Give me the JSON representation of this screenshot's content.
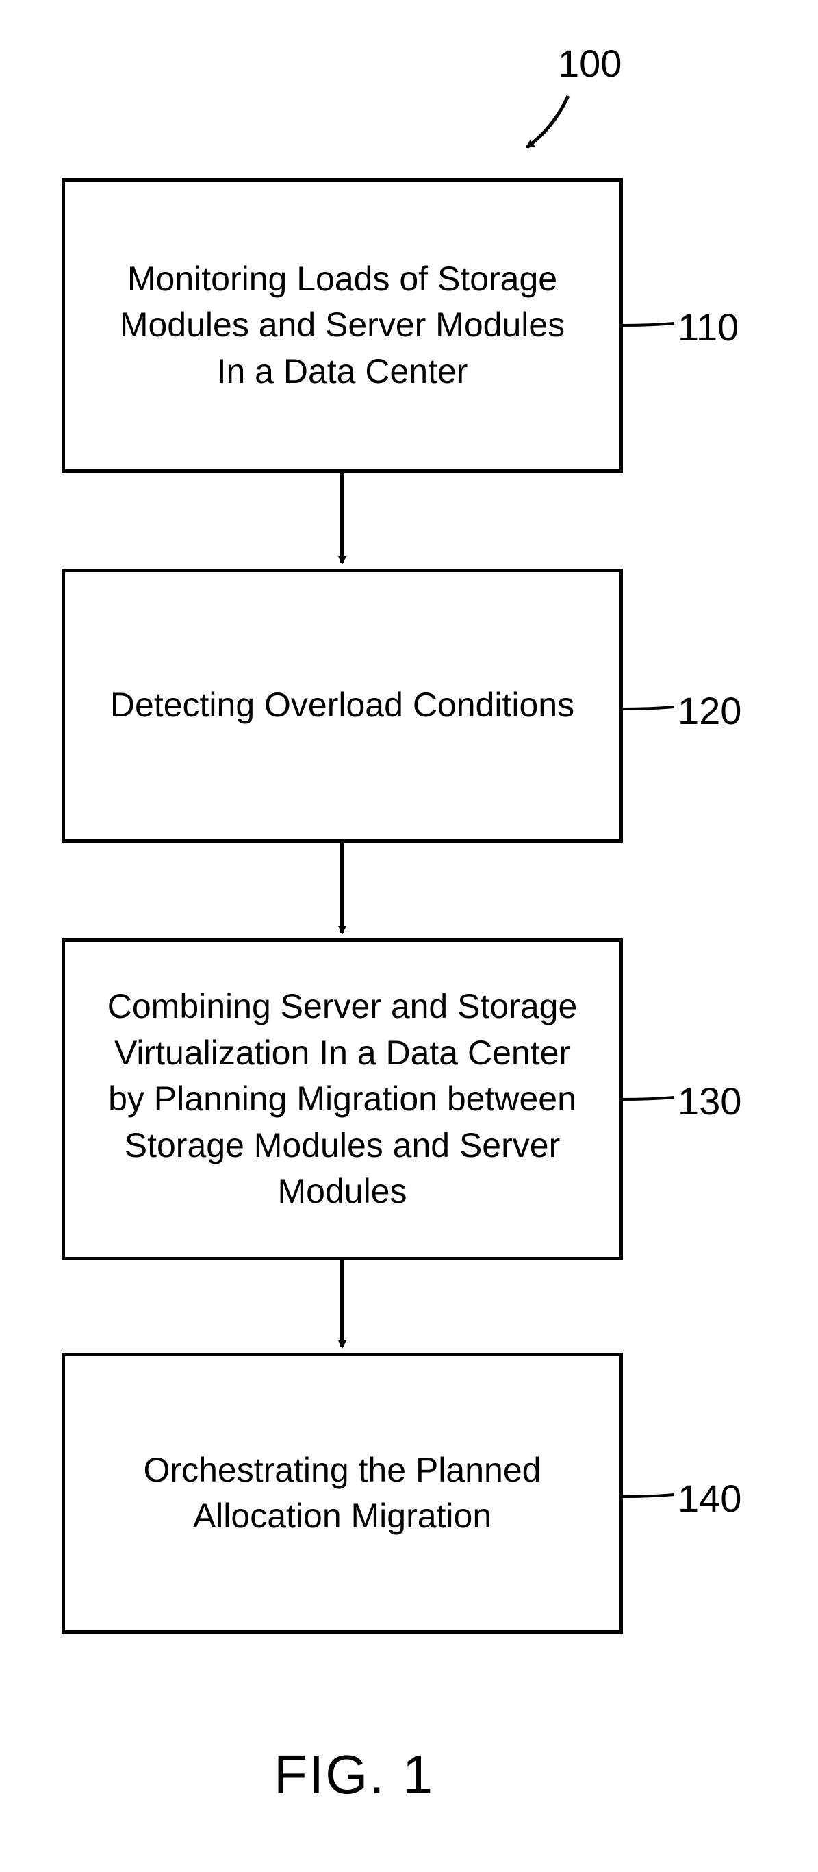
{
  "figure": {
    "ref_main": "100",
    "caption": "FIG. 1"
  },
  "boxes": {
    "b110": {
      "text": "Monitoring Loads of Storage Modules and Server Modules In a Data Center",
      "ref": "110"
    },
    "b120": {
      "text": "Detecting Overload Conditions",
      "ref": "120"
    },
    "b130": {
      "text": "Combining Server and Storage Virtualization In a Data Center by Planning Migration between Storage Modules and Server Modules",
      "ref": "130"
    },
    "b140": {
      "text": "Orchestrating the Planned Allocation Migration",
      "ref": "140"
    }
  },
  "chart_data": {
    "type": "flowchart",
    "title": "FIG. 1",
    "reference_numeral": "100",
    "nodes": [
      {
        "id": "110",
        "label": "Monitoring Loads of Storage Modules and Server Modules In a Data Center"
      },
      {
        "id": "120",
        "label": "Detecting Overload Conditions"
      },
      {
        "id": "130",
        "label": "Combining Server and Storage Virtualization In a Data Center by Planning Migration between Storage Modules and Server Modules"
      },
      {
        "id": "140",
        "label": "Orchestrating the Planned Allocation Migration"
      }
    ],
    "edges": [
      {
        "from": "110",
        "to": "120"
      },
      {
        "from": "120",
        "to": "130"
      },
      {
        "from": "130",
        "to": "140"
      }
    ]
  }
}
